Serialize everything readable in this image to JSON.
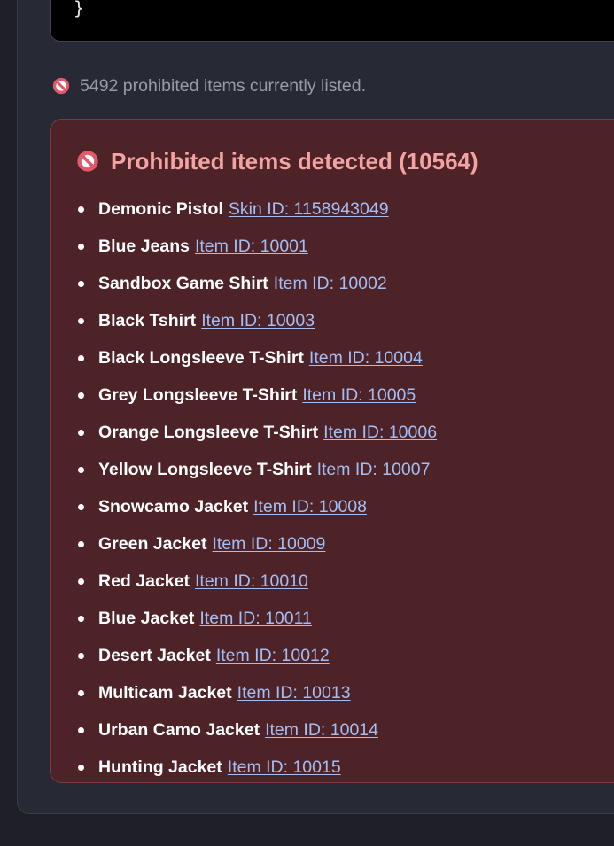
{
  "code_block": {
    "closing_brace": "}"
  },
  "notice": {
    "icon": "prohibited-icon",
    "text": "5492 prohibited items currently listed."
  },
  "alert": {
    "icon": "prohibited-icon",
    "title": "Prohibited items detected (10564)",
    "items": [
      {
        "name": "Demonic Pistol",
        "link": "Skin ID: 1158943049"
      },
      {
        "name": "Blue Jeans",
        "link": "Item ID: 10001"
      },
      {
        "name": "Sandbox Game Shirt",
        "link": "Item ID: 10002"
      },
      {
        "name": "Black Tshirt",
        "link": "Item ID: 10003"
      },
      {
        "name": "Black Longsleeve T-Shirt",
        "link": "Item ID: 10004"
      },
      {
        "name": "Grey Longsleeve T-Shirt",
        "link": "Item ID: 10005"
      },
      {
        "name": "Orange Longsleeve T-Shirt",
        "link": "Item ID: 10006"
      },
      {
        "name": "Yellow Longsleeve T-Shirt",
        "link": "Item ID: 10007"
      },
      {
        "name": "Snowcamo Jacket",
        "link": "Item ID: 10008"
      },
      {
        "name": "Green Jacket",
        "link": "Item ID: 10009"
      },
      {
        "name": "Red Jacket",
        "link": "Item ID: 10010"
      },
      {
        "name": "Blue Jacket",
        "link": "Item ID: 10011"
      },
      {
        "name": "Desert Jacket",
        "link": "Item ID: 10012"
      },
      {
        "name": "Multicam Jacket",
        "link": "Item ID: 10013"
      },
      {
        "name": "Urban Camo Jacket",
        "link": "Item ID: 10014"
      },
      {
        "name": "Hunting Jacket",
        "link": "Item ID: 10015"
      }
    ]
  },
  "colors": {
    "background": "#1e1f27",
    "panel": "#272a35",
    "alert_background": "#4e2328",
    "alert_border": "#7c3a3f",
    "alert_title": "#f4a3a3",
    "link": "#a3bef5",
    "icon_red": "#e05a6b"
  }
}
